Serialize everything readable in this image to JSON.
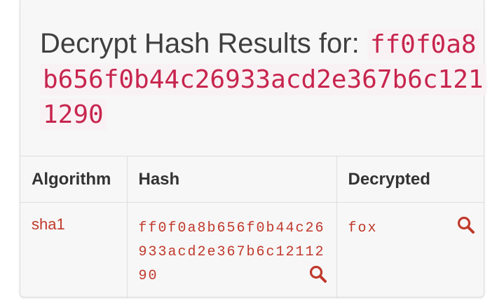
{
  "heading": {
    "label": "Decrypt Hash Results for:",
    "hash": "ff0f0a8b656f0b44c26933acd2e367b6c1211290"
  },
  "table": {
    "columns": [
      "Algorithm",
      "Hash",
      "Decrypted"
    ],
    "rows": [
      {
        "algorithm": "sha1",
        "hash": "ff0f0a8b656f0b44c26933acd2e367b6c1211290",
        "decrypted": "fox"
      }
    ]
  },
  "icons": {
    "hash_lookup": "search-icon",
    "decrypted_lookup": "search-icon"
  },
  "colors": {
    "accent": "#c0392b",
    "code": "#c7254e",
    "code_bg": "#f9f2f4"
  }
}
